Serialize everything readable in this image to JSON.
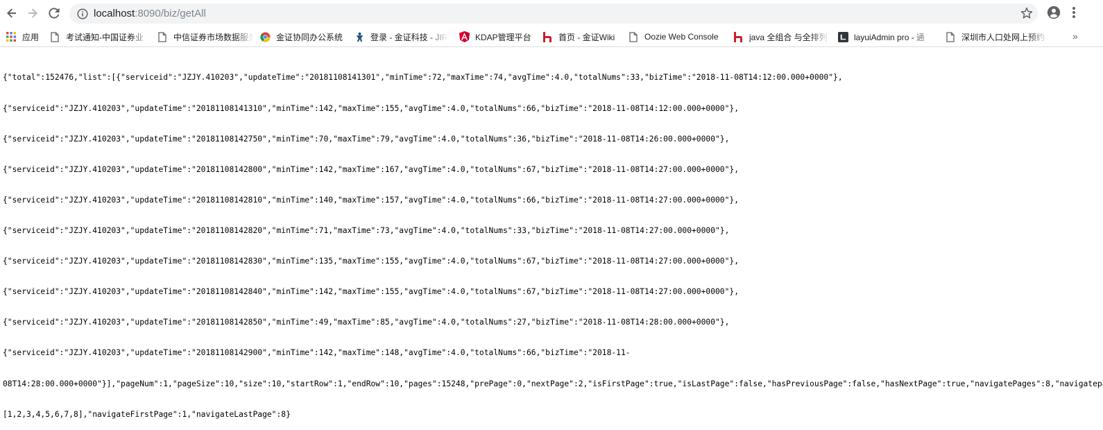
{
  "browser": {
    "url_host": "localhost",
    "url_rest": ":8090/biz/getAll",
    "icons": {
      "back": "back-arrow-icon",
      "forward": "forward-arrow-icon",
      "reload": "reload-icon",
      "info": "info-icon",
      "star": "star-icon",
      "account": "account-icon",
      "menu": "menu-icon"
    }
  },
  "bookmarks": [
    {
      "label": "应用",
      "icon": "apps-icon"
    },
    {
      "label": "考试通知-中国证券业",
      "icon": "page-icon"
    },
    {
      "label": "中信证券市场数据服务",
      "icon": "page-icon"
    },
    {
      "label": "金证协同办公系统",
      "icon": "chrome-favicon-icon"
    },
    {
      "label": "登录 - 金证科技 - JIR",
      "icon": "jira-icon"
    },
    {
      "label": "KDAP管理平台",
      "icon": "angular-icon"
    },
    {
      "label": "首页 - 金证Wiki",
      "icon": "h-favicon-icon"
    },
    {
      "label": "Oozie Web Console",
      "icon": "page-icon"
    },
    {
      "label": "java 全组合 与全排列",
      "icon": "h-favicon-icon"
    },
    {
      "label": "layuiAdmin pro - 通",
      "icon": "layui-icon"
    },
    {
      "label": "深圳市人口处网上预约",
      "icon": "page-icon"
    }
  ],
  "bookmarks_overflow": "»",
  "json_lines": [
    "{\"total\":152476,\"list\":[{\"serviceid\":\"JZJY.410203\",\"updateTime\":\"20181108141301\",\"minTime\":72,\"maxTime\":74,\"avgTime\":4.0,\"totalNums\":33,\"bizTime\":\"2018-11-08T14:12:00.000+0000\"},",
    "{\"serviceid\":\"JZJY.410203\",\"updateTime\":\"20181108141310\",\"minTime\":142,\"maxTime\":155,\"avgTime\":4.0,\"totalNums\":66,\"bizTime\":\"2018-11-08T14:12:00.000+0000\"},",
    "{\"serviceid\":\"JZJY.410203\",\"updateTime\":\"20181108142750\",\"minTime\":70,\"maxTime\":79,\"avgTime\":4.0,\"totalNums\":36,\"bizTime\":\"2018-11-08T14:26:00.000+0000\"},",
    "{\"serviceid\":\"JZJY.410203\",\"updateTime\":\"20181108142800\",\"minTime\":142,\"maxTime\":167,\"avgTime\":4.0,\"totalNums\":67,\"bizTime\":\"2018-11-08T14:27:00.000+0000\"},",
    "{\"serviceid\":\"JZJY.410203\",\"updateTime\":\"20181108142810\",\"minTime\":140,\"maxTime\":157,\"avgTime\":4.0,\"totalNums\":66,\"bizTime\":\"2018-11-08T14:27:00.000+0000\"},",
    "{\"serviceid\":\"JZJY.410203\",\"updateTime\":\"20181108142820\",\"minTime\":71,\"maxTime\":73,\"avgTime\":4.0,\"totalNums\":33,\"bizTime\":\"2018-11-08T14:27:00.000+0000\"},",
    "{\"serviceid\":\"JZJY.410203\",\"updateTime\":\"20181108142830\",\"minTime\":135,\"maxTime\":155,\"avgTime\":4.0,\"totalNums\":67,\"bizTime\":\"2018-11-08T14:27:00.000+0000\"},",
    "{\"serviceid\":\"JZJY.410203\",\"updateTime\":\"20181108142840\",\"minTime\":142,\"maxTime\":155,\"avgTime\":4.0,\"totalNums\":67,\"bizTime\":\"2018-11-08T14:27:00.000+0000\"},",
    "{\"serviceid\":\"JZJY.410203\",\"updateTime\":\"20181108142850\",\"minTime\":49,\"maxTime\":85,\"avgTime\":4.0,\"totalNums\":27,\"bizTime\":\"2018-11-08T14:28:00.000+0000\"},",
    "{\"serviceid\":\"JZJY.410203\",\"updateTime\":\"20181108142900\",\"minTime\":142,\"maxTime\":148,\"avgTime\":4.0,\"totalNums\":66,\"bizTime\":\"2018-11-",
    "08T14:28:00.000+0000\"}],\"pageNum\":1,\"pageSize\":10,\"size\":10,\"startRow\":1,\"endRow\":10,\"pages\":15248,\"prePage\":0,\"nextPage\":2,\"isFirstPage\":true,\"isLastPage\":false,\"hasPreviousPage\":false,\"hasNextPage\":true,\"navigatePages\":8,\"navigatepageNums\":",
    "[1,2,3,4,5,6,7,8],\"navigateFirstPage\":1,\"navigateLastPage\":8}"
  ]
}
